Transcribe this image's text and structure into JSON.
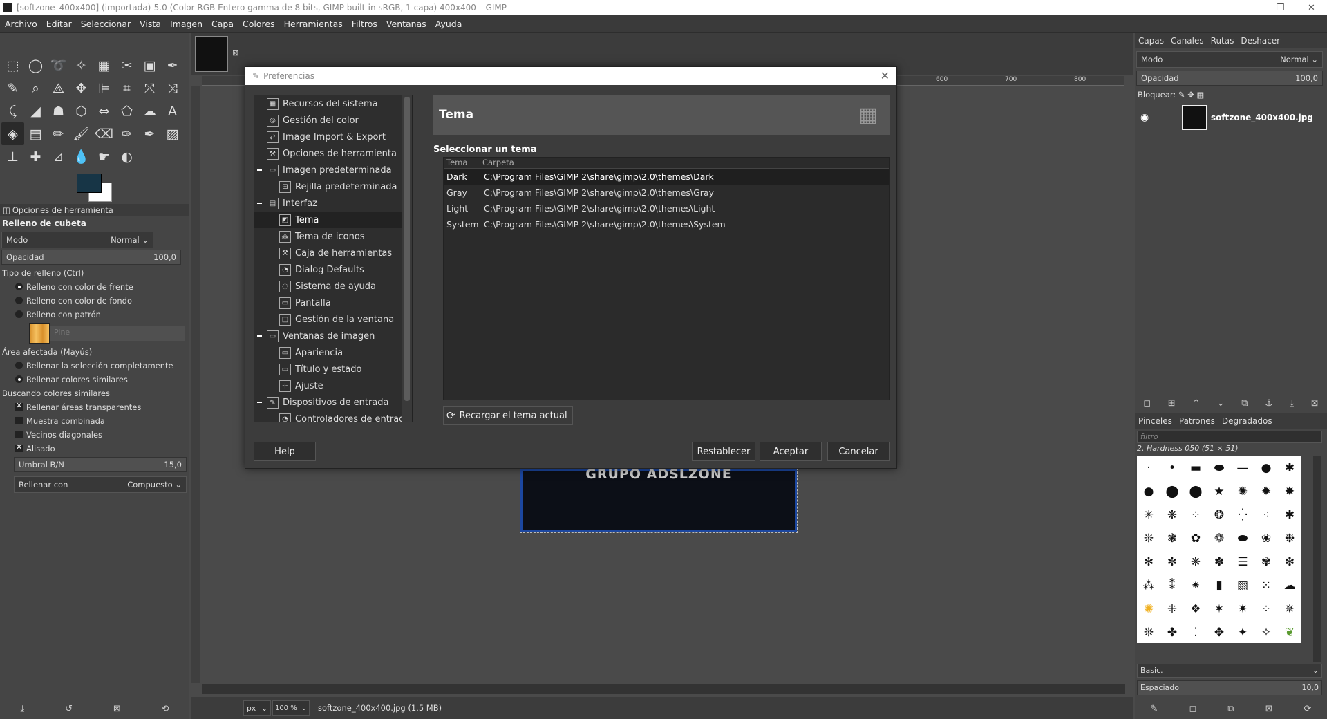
{
  "window": {
    "title": "[softzone_400x400] (importada)-5.0 (Color RGB Entero gamma de 8 bits, GIMP built-in sRGB, 1 capa) 400x400 – GIMP"
  },
  "menu": [
    "Archivo",
    "Editar",
    "Seleccionar",
    "Vista",
    "Imagen",
    "Capa",
    "Colores",
    "Herramientas",
    "Filtros",
    "Ventanas",
    "Ayuda"
  ],
  "colors": {
    "foreground": "#173546",
    "background": "#ffffff",
    "accent": "#1c47a0"
  },
  "tool_options": {
    "tab": "Opciones de herramienta",
    "title": "Relleno de cubeta",
    "mode_label": "Modo",
    "mode_value": "Normal",
    "opacity_label": "Opacidad",
    "opacity_value": "100,0",
    "fill_type_label": "Tipo de relleno  (Ctrl)",
    "fill_types": [
      {
        "label": "Relleno con color de frente",
        "checked": true
      },
      {
        "label": "Relleno con color de fondo",
        "checked": false
      },
      {
        "label": "Relleno con patrón",
        "checked": false
      }
    ],
    "pattern_name": "Pine",
    "area_label": "Área afectada  (Mayús)",
    "areas": [
      {
        "label": "Rellenar la selección completamente",
        "checked": false
      },
      {
        "label": "Rellenar colores similares",
        "checked": true
      }
    ],
    "similar_label": "Buscando colores similares",
    "similar_checks": [
      {
        "label": "Rellenar áreas transparentes",
        "checked": true
      },
      {
        "label": "Muestra combinada",
        "checked": false
      },
      {
        "label": "Vecinos diagonales",
        "checked": false
      },
      {
        "label": "Alisado",
        "checked": true
      }
    ],
    "threshold_label": "Umbral B/N",
    "threshold_value": "15,0",
    "fill_with_label": "Rellenar con",
    "fill_with_value": "Compuesto"
  },
  "canvas": {
    "ruler_marks": [
      "600",
      "700",
      "800"
    ],
    "image_text": "GRUPO ADSLZONE",
    "unit": "px",
    "zoom": "100 %",
    "status_file": "softzone_400x400.jpg (1,5 MB)"
  },
  "right_dock": {
    "tabs": [
      "Capas",
      "Canales",
      "Rutas",
      "Deshacer"
    ],
    "mode_label": "Modo",
    "mode_value": "Normal",
    "opacity_label": "Opacidad",
    "opacity_value": "100,0",
    "lock_label": "Bloquear:",
    "layer_name": "softzone_400x400.jpg",
    "brush_tabs": [
      "Pinceles",
      "Patrones",
      "Degradados"
    ],
    "filter_placeholder": "filtro",
    "brush_name": "2. Hardness 050 (51 × 51)",
    "brush_set": "Basic.",
    "spacing_label": "Espaciado",
    "spacing_value": "10,0"
  },
  "dialog": {
    "title": "Preferencias",
    "tree": [
      {
        "label": "Recursos del sistema",
        "level": 1,
        "icon": "chip-icon"
      },
      {
        "label": "Gestión del color",
        "level": 1,
        "icon": "color-icon"
      },
      {
        "label": "Image Import & Export",
        "level": 1,
        "icon": "import-icon"
      },
      {
        "label": "Opciones de herramienta",
        "level": 1,
        "icon": "tool-options-icon"
      },
      {
        "label": "Imagen predeterminada",
        "level": 1,
        "icon": "image-icon",
        "expanded": true
      },
      {
        "label": "Rejilla predeterminada",
        "level": 2,
        "icon": "grid-icon"
      },
      {
        "label": "Interfaz",
        "level": 1,
        "icon": "interface-icon",
        "expanded": true
      },
      {
        "label": "Tema",
        "level": 2,
        "icon": "theme-icon",
        "selected": true
      },
      {
        "label": "Tema de iconos",
        "level": 2,
        "icon": "icon-theme-icon"
      },
      {
        "label": "Caja de herramientas",
        "level": 2,
        "icon": "toolbox-icon"
      },
      {
        "label": "Dialog Defaults",
        "level": 2,
        "icon": "dialog-icon"
      },
      {
        "label": "Sistema de ayuda",
        "level": 2,
        "icon": "help-icon"
      },
      {
        "label": "Pantalla",
        "level": 2,
        "icon": "display-icon"
      },
      {
        "label": "Gestión de la ventana",
        "level": 2,
        "icon": "window-icon"
      },
      {
        "label": "Ventanas de imagen",
        "level": 1,
        "icon": "image-window-icon",
        "expanded": true
      },
      {
        "label": "Apariencia",
        "level": 2,
        "icon": "appearance-icon"
      },
      {
        "label": "Título y estado",
        "level": 2,
        "icon": "title-icon"
      },
      {
        "label": "Ajuste",
        "level": 2,
        "icon": "snap-icon"
      },
      {
        "label": "Dispositivos de entrada",
        "level": 1,
        "icon": "input-icon",
        "expanded": true
      },
      {
        "label": "Controladores de entrada",
        "level": 2,
        "icon": "controller-icon"
      }
    ],
    "panel_title": "Tema",
    "select_label": "Seleccionar un tema",
    "columns": [
      "Tema",
      "Carpeta"
    ],
    "themes": [
      {
        "name": "Dark",
        "folder": "C:\\Program Files\\GIMP 2\\share\\gimp\\2.0\\themes\\Dark",
        "selected": true
      },
      {
        "name": "Gray",
        "folder": "C:\\Program Files\\GIMP 2\\share\\gimp\\2.0\\themes\\Gray",
        "selected": false
      },
      {
        "name": "Light",
        "folder": "C:\\Program Files\\GIMP 2\\share\\gimp\\2.0\\themes\\Light",
        "selected": false
      },
      {
        "name": "System",
        "folder": "C:\\Program Files\\GIMP 2\\share\\gimp\\2.0\\themes\\System",
        "selected": false
      }
    ],
    "reload_label": "Recargar el tema actual",
    "help_label": "Help",
    "reset_label": "Restablecer",
    "ok_label": "Aceptar",
    "cancel_label": "Cancelar"
  }
}
